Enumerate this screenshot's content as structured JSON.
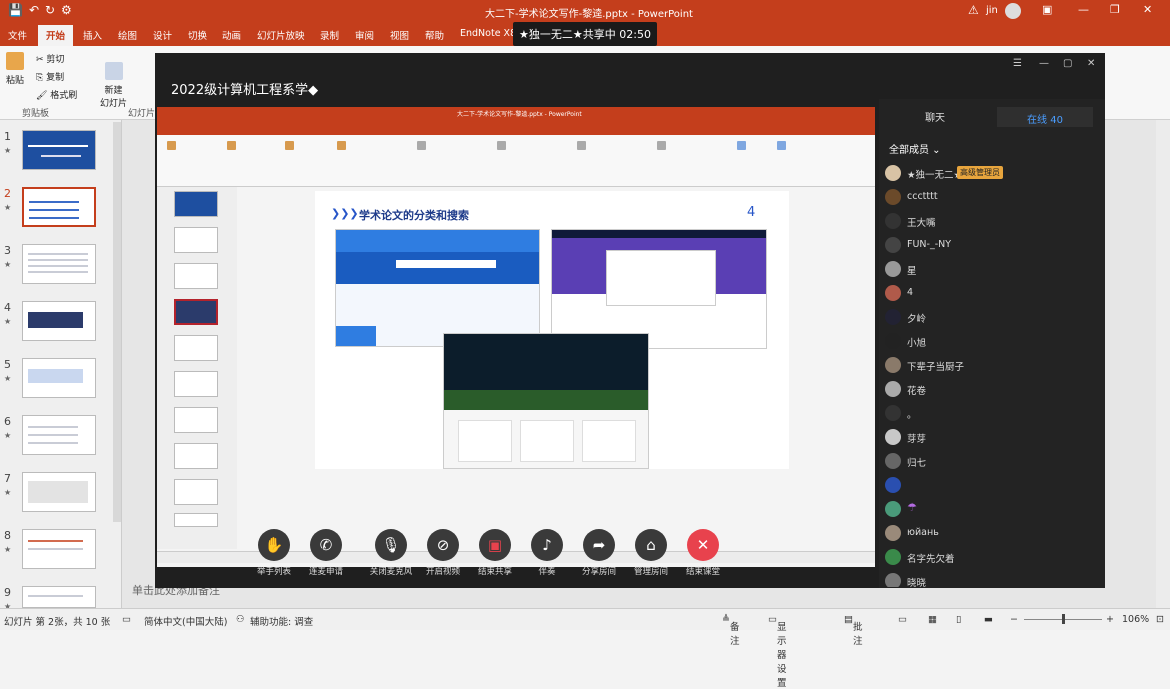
{
  "titlebar": {
    "title": "大二下-学术论文写作-黎逵.pptx - PowerPoint",
    "user": "jin"
  },
  "ribbon_tabs": [
    "文件",
    "开始",
    "插入",
    "绘图",
    "设计",
    "切换",
    "动画",
    "幻灯片放映",
    "录制",
    "审阅",
    "视图",
    "帮助",
    "EndNote X8"
  ],
  "share_badge": "★独一无二★共享中 02:50",
  "ribbon": {
    "paste": "粘贴",
    "cut": "剪切",
    "copy": "复制",
    "format_painter": "格式刷",
    "new_slide": "新建\n幻灯片",
    "clipboard_group": "剪贴板",
    "slides_group": "幻灯片"
  },
  "thumbnails": [
    {
      "num": "1"
    },
    {
      "num": "2"
    },
    {
      "num": "3"
    },
    {
      "num": "4"
    },
    {
      "num": "5"
    },
    {
      "num": "6"
    },
    {
      "num": "7"
    },
    {
      "num": "8"
    },
    {
      "num": "9"
    }
  ],
  "notes_placeholder": "单击此处添加备注",
  "statusbar": {
    "slide_info": "幻灯片 第 2张，共 10 张",
    "language": "简体中文(中国大陆)",
    "accessibility": "辅助功能: 调查",
    "notes": "备注",
    "display": "显示器设置",
    "comments": "批注",
    "zoom": "106%"
  },
  "meeting": {
    "title": "2022级计算机工程系学",
    "shared_slide": {
      "heading": "学术论文的分类和搜索",
      "page_number": "4",
      "shared_titlebar": "大二下-学术论文写作-黎逵.pptx - PowerPoint"
    },
    "toolbar": [
      {
        "icon": "hand-raise-icon",
        "label": "举手列表"
      },
      {
        "icon": "phone-icon",
        "label": "连麦申请"
      },
      {
        "icon": "mic-icon",
        "label": "关闭麦克风"
      },
      {
        "icon": "camera-off-icon",
        "label": "开启视频"
      },
      {
        "icon": "stop-share-icon",
        "label": "结束共享"
      },
      {
        "icon": "music-icon",
        "label": "伴奏"
      },
      {
        "icon": "share-icon",
        "label": "分享房间"
      },
      {
        "icon": "room-manage-icon",
        "label": "管理房间"
      },
      {
        "icon": "end-class-icon",
        "label": "结束课堂"
      }
    ],
    "panel": {
      "chat_tab": "聊天",
      "online_tab": "在线 40",
      "filter": "全部成员",
      "admin_badge": "高级管理员",
      "members": [
        "★独一无二★",
        "ccctttt",
        "王大嘴",
        "FUN-_-NY",
        "星",
        "4",
        "夕岭",
        "小旭",
        "下辈子当厨子",
        "花卷",
        "。",
        "芽芽",
        "归七",
        "",
        "",
        "юйань",
        "名字先欠着",
        "晓晓"
      ]
    }
  }
}
